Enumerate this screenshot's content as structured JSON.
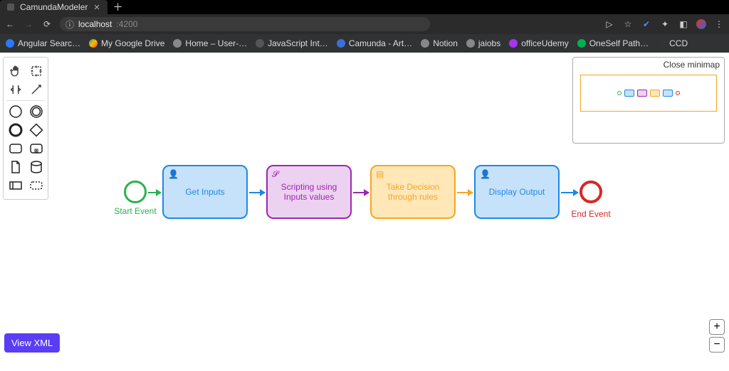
{
  "window": {
    "title": "CamundaModeler"
  },
  "url": {
    "host": "localhost",
    "port": ":4200"
  },
  "bookmarks": [
    {
      "label": "Angular Searc…",
      "color": "#2979ff"
    },
    {
      "label": "My Google Drive",
      "color": "#34a853"
    },
    {
      "label": "Home – User-…",
      "color": "#888"
    },
    {
      "label": "JavaScript Int…",
      "color": "#888"
    },
    {
      "label": "Camunda - Art…",
      "color": "#3a6fd8"
    },
    {
      "label": "Notion",
      "color": "#888"
    },
    {
      "label": "jaiobs",
      "color": "#888"
    },
    {
      "label": "officeUdemy",
      "color": "#a435f0"
    },
    {
      "label": "OneSelf Path…",
      "color": "#00b14f"
    },
    {
      "label": "CCD",
      "color": "#333"
    }
  ],
  "diagram": {
    "start_label": "Start Event",
    "end_label": "End Event",
    "tasks": [
      {
        "label": "Get Inputs",
        "type": "user"
      },
      {
        "label": "Scripting using Inputs values",
        "type": "script"
      },
      {
        "label": "Take Decision through rules",
        "type": "rule"
      },
      {
        "label": "Display Output",
        "type": "user"
      }
    ]
  },
  "minimap": {
    "close_label": "Close minimap"
  },
  "actions": {
    "view_xml": "View XML",
    "zoom_in": "+",
    "zoom_out": "−"
  }
}
